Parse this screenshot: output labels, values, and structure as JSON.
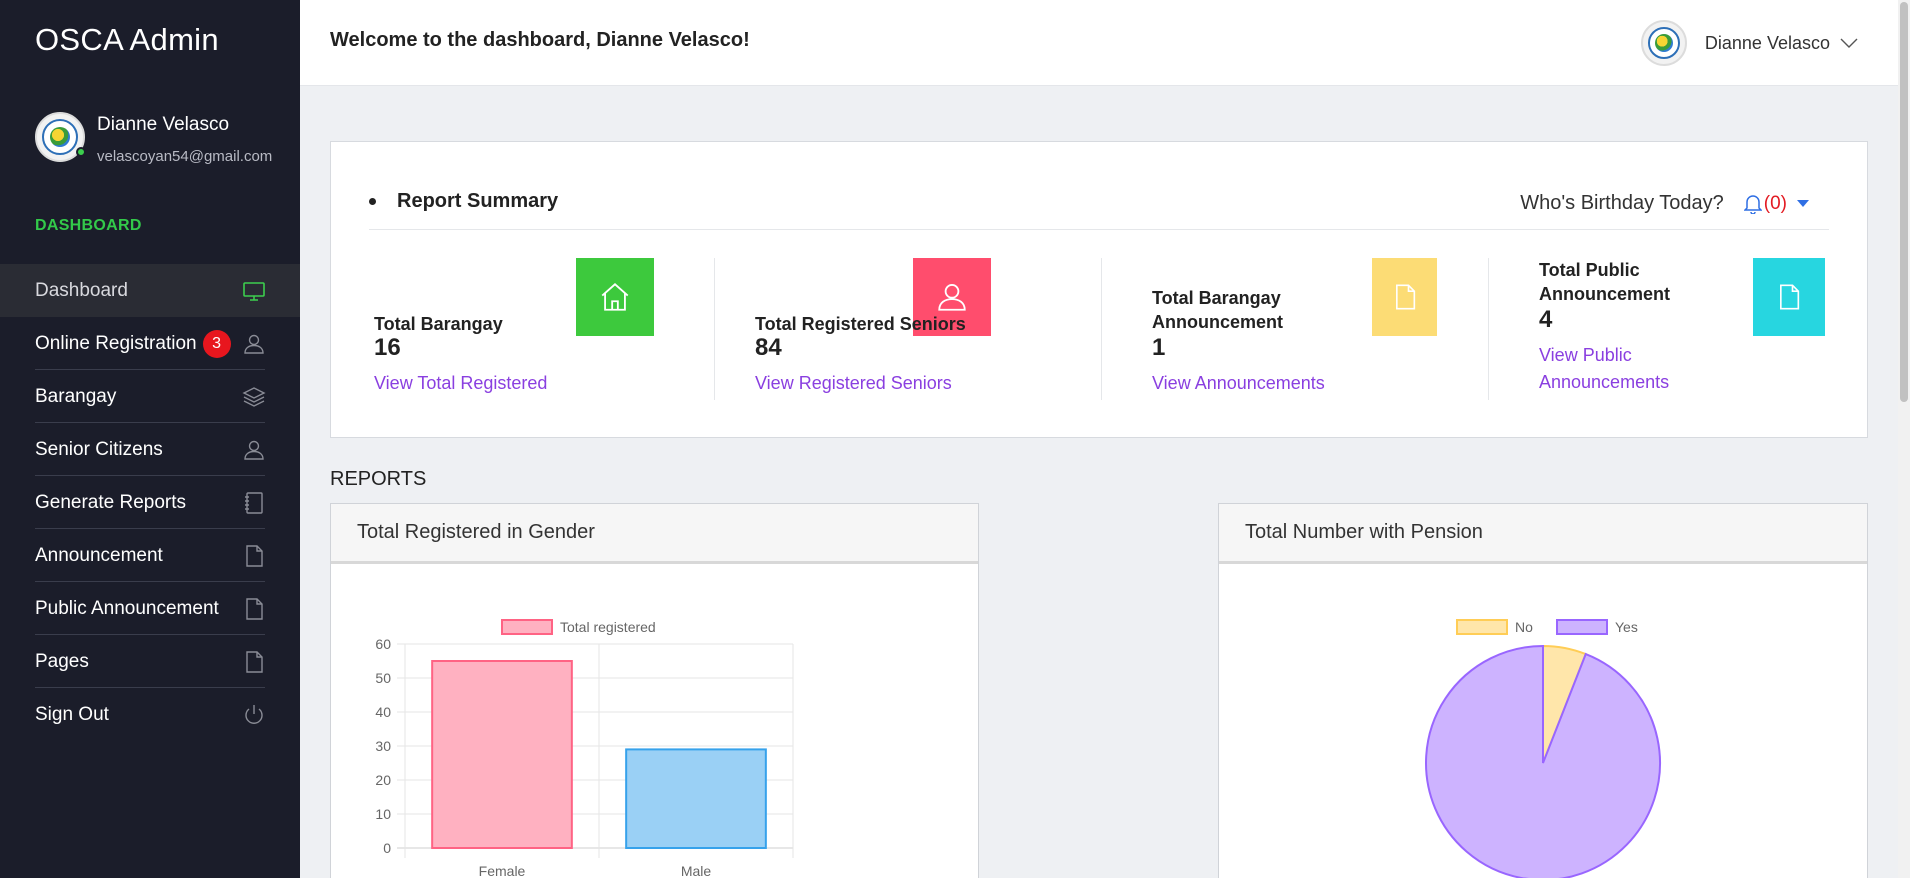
{
  "sidebar": {
    "brand": "OSCA Admin",
    "user_name": "Dianne Velasco",
    "user_email": "velascoyan54@gmail.com",
    "section_label": "DASHBOARD",
    "items": [
      {
        "label": "Dashboard",
        "icon": "monitor-icon",
        "active": true
      },
      {
        "label": "Online Registration",
        "icon": "user-icon",
        "badge": "3"
      },
      {
        "label": "Barangay",
        "icon": "layers-icon"
      },
      {
        "label": "Senior Citizens",
        "icon": "user-icon"
      },
      {
        "label": "Generate Reports",
        "icon": "notebook-icon"
      },
      {
        "label": "Announcement",
        "icon": "document-icon"
      },
      {
        "label": "Public Announcement",
        "icon": "document-icon"
      },
      {
        "label": "Pages",
        "icon": "document-icon"
      },
      {
        "label": "Sign Out",
        "icon": "power-icon"
      }
    ]
  },
  "topbar": {
    "welcome": "Welcome to the dashboard, Dianne Velasco!",
    "user_name": "Dianne Velasco"
  },
  "summary": {
    "title": "Report Summary",
    "birthday_label": "Who's Birthday Today?",
    "birthday_count": "(0)",
    "stats": [
      {
        "label": "Total Barangay",
        "value": "16",
        "link": "View Total Registered",
        "color": "#3dc93d",
        "icon": "home-icon"
      },
      {
        "label": "Total Registered Seniors",
        "value": "84",
        "link": "View Registered Seniors",
        "color": "#ff4d6d",
        "icon": "user-icon"
      },
      {
        "label": "Total Barangay Announcement",
        "value": "1",
        "link": "View Announcements",
        "color": "#fcdc75",
        "icon": "document-icon"
      },
      {
        "label": "Total Public Announcement",
        "value": "4",
        "link": "View Public Announcements",
        "color": "#27d6e0",
        "icon": "document-icon"
      }
    ]
  },
  "reports": {
    "title": "REPORTS",
    "gender_panel_title": "Total Registered in Gender",
    "pension_panel_title": "Total Number with Pension"
  },
  "chart_data": [
    {
      "type": "bar",
      "title": "",
      "categories": [
        "Female",
        "Male"
      ],
      "series": [
        {
          "name": "Total registered",
          "values": [
            55,
            29
          ]
        }
      ],
      "ylim": [
        0,
        60
      ],
      "yticks": [
        0,
        10,
        20,
        30,
        40,
        50,
        60
      ],
      "grid": true,
      "legend": "top",
      "colors": {
        "bar_fills": [
          "#ffb1c1",
          "#9ad0f5"
        ],
        "bar_strokes": [
          "#ff6384",
          "#36a2eb"
        ]
      }
    },
    {
      "type": "pie",
      "title": "",
      "labels": [
        "No",
        "Yes"
      ],
      "values": [
        5,
        79
      ],
      "legend": "top",
      "colors": {
        "fills": [
          "#ffe6aa",
          "#cdb3ff"
        ],
        "strokes": [
          "#ffcd56",
          "#9966ff"
        ]
      }
    }
  ]
}
